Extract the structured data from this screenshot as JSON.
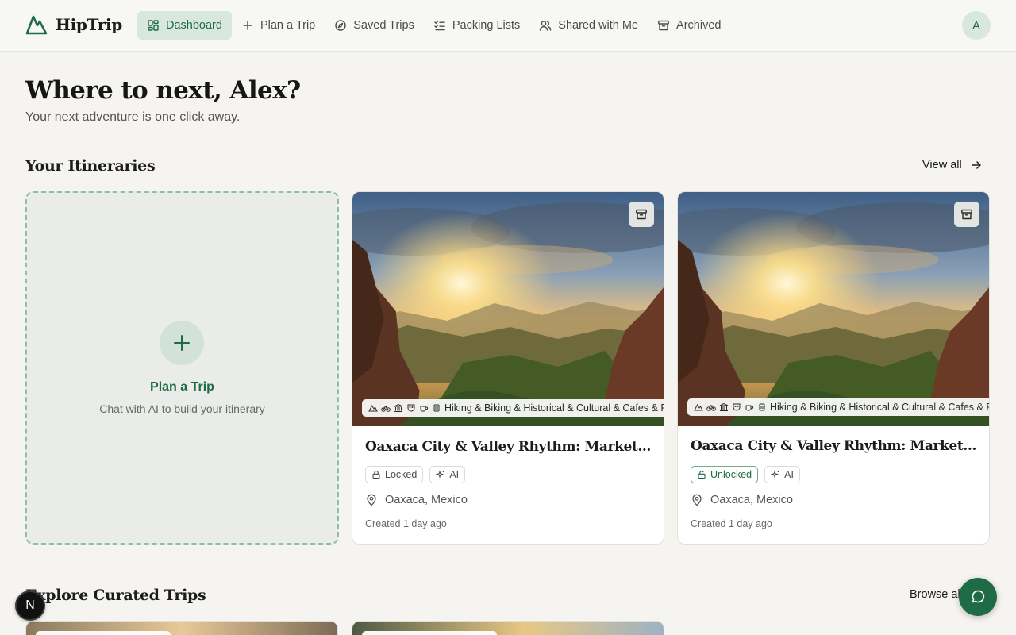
{
  "brand": {
    "name": "HipTrip",
    "accent": "#1f6b46"
  },
  "nav": {
    "items": [
      {
        "label": "Dashboard",
        "icon": "dashboard-grid-icon",
        "active": true
      },
      {
        "label": "Plan a Trip",
        "icon": "plus-icon"
      },
      {
        "label": "Saved Trips",
        "icon": "compass-icon"
      },
      {
        "label": "Packing Lists",
        "icon": "checklist-icon"
      },
      {
        "label": "Shared with Me",
        "icon": "users-icon"
      },
      {
        "label": "Archived",
        "icon": "archive-icon"
      }
    ]
  },
  "user": {
    "initial": "A"
  },
  "hero": {
    "title": "Where to next, Alex?",
    "subtitle": "Your next adventure is one click away."
  },
  "itineraries": {
    "title": "Your Itineraries",
    "view_all": "View all",
    "plan_card": {
      "title": "Plan a Trip",
      "subtitle": "Chat with AI to build your itinerary"
    },
    "trips": [
      {
        "tags": "Hiking & Biking & Historical & Cultural & Cafes & Restaurants",
        "title": "Oaxaca City & Valley Rhythm: Markets, Mezcal & Monte Albán",
        "status": "Locked",
        "source": "AI",
        "location": "Oaxaca, Mexico",
        "created": "Created 1 day ago"
      },
      {
        "tags": "Hiking & Biking & Historical & Cultural & Cafes & Restaurants",
        "title": "Oaxaca City & Valley Rhythm: Markets, Mezcal & Monte Albán",
        "status": "Unlocked",
        "source": "AI",
        "location": "Oaxaca, Mexico",
        "created": "Created 1 day ago"
      }
    ]
  },
  "curated": {
    "title": "Explore Curated Trips",
    "browse_all": "Browse all"
  },
  "floating": {
    "badge_letter": "N"
  }
}
